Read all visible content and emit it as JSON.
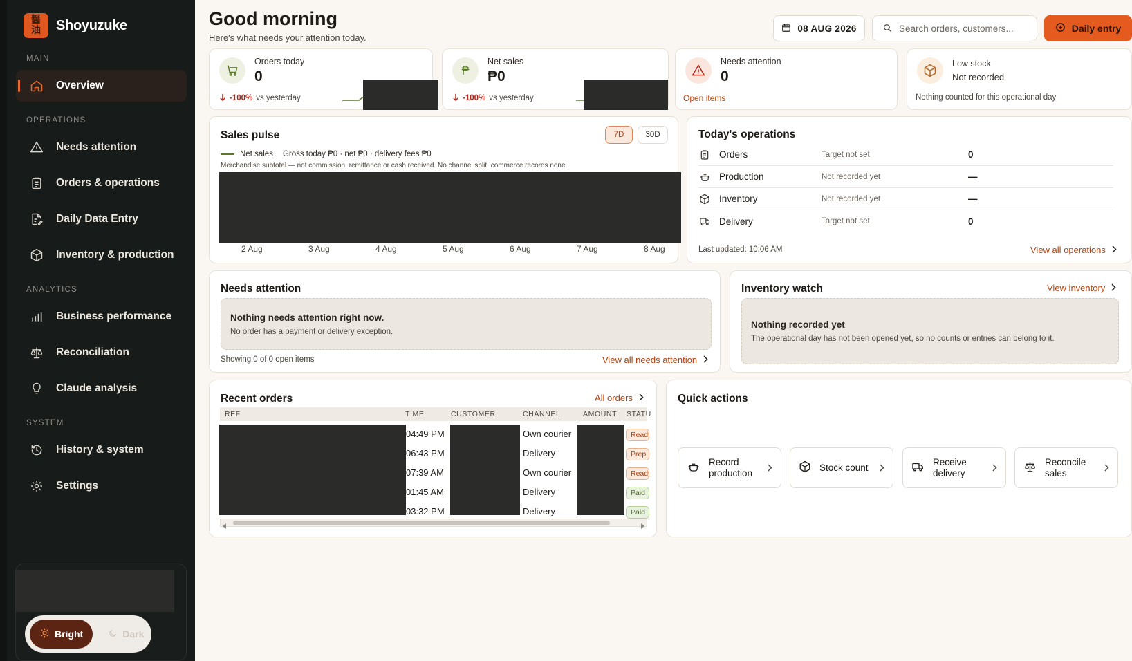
{
  "brand": {
    "name": "Shoyuzuke",
    "logo_top": "醤",
    "logo_bottom": "油"
  },
  "sidebar": {
    "sections": {
      "main": "MAIN",
      "operations": "OPERATIONS",
      "analytics": "ANALYTICS",
      "system": "SYSTEM"
    },
    "items": [
      {
        "label": "Overview",
        "icon": "home-icon"
      },
      {
        "label": "Needs attention",
        "icon": "warning-icon"
      },
      {
        "label": "Orders & operations",
        "icon": "clipboard-icon"
      },
      {
        "label": "Daily Data Entry",
        "icon": "document-edit-icon"
      },
      {
        "label": "Inventory & production",
        "icon": "box-icon"
      },
      {
        "label": "Business performance",
        "icon": "bar-chart-icon"
      },
      {
        "label": "Reconciliation",
        "icon": "scale-icon"
      },
      {
        "label": "Claude analysis",
        "icon": "lightbulb-icon"
      },
      {
        "label": "History & system",
        "icon": "history-icon"
      },
      {
        "label": "Settings",
        "icon": "gear-icon"
      }
    ],
    "theme": {
      "bright": "Bright",
      "dark": "Dark"
    }
  },
  "header": {
    "greeting": "Good morning",
    "subtitle": "Here's what needs your attention today.",
    "date": "08 AUG 2026",
    "search_placeholder": "Search orders, customers...",
    "entry_button": "Daily entry"
  },
  "kpis": {
    "orders": {
      "label": "Orders today",
      "value": "0",
      "delta": "-100%",
      "delta_suffix": "vs yesterday"
    },
    "sales": {
      "label": "Net sales",
      "value": "₱0",
      "delta": "-100%",
      "delta_suffix": "vs yesterday"
    },
    "attention": {
      "label": "Needs attention",
      "value": "0",
      "link": "Open items"
    },
    "stock": {
      "label": "Low stock",
      "value": "Not recorded",
      "note": "Nothing counted for this operational day"
    }
  },
  "sales_pulse": {
    "title": "Sales pulse",
    "ranges": [
      "7D",
      "30D"
    ],
    "selected_range": "7D",
    "legend": "Net sales",
    "summary": "Gross today ₱0 · net ₱0 · delivery fees ₱0",
    "note": "Merchandise subtotal — not commission, remittance or cash received. No channel split: commerce records none.",
    "x_labels": [
      "2 Aug",
      "3 Aug",
      "4 Aug",
      "5 Aug",
      "6 Aug",
      "7 Aug",
      "8 Aug"
    ]
  },
  "operations": {
    "title": "Today's operations",
    "rows": [
      {
        "name": "Orders",
        "status": "Target not set",
        "value": "0",
        "icon": "clipboard-icon"
      },
      {
        "name": "Production",
        "status": "Not recorded yet",
        "value": "—",
        "icon": "pot-icon"
      },
      {
        "name": "Inventory",
        "status": "Not recorded yet",
        "value": "—",
        "icon": "box-icon"
      },
      {
        "name": "Delivery",
        "status": "Target not set",
        "value": "0",
        "icon": "truck-icon"
      }
    ],
    "updated": "Last updated: 10:06 AM",
    "link": "View all operations"
  },
  "needs_attention": {
    "title": "Needs attention",
    "empty_title": "Nothing needs attention right now.",
    "empty_sub": "No order has a payment or delivery exception.",
    "count": "Showing 0 of 0 open items",
    "link": "View all needs attention"
  },
  "inventory_watch": {
    "title": "Inventory watch",
    "link": "View inventory",
    "empty_title": "Nothing recorded yet",
    "empty_sub": "The operational day has not been opened yet, so no counts or entries can belong to it."
  },
  "recent_orders": {
    "title": "Recent orders",
    "link": "All orders",
    "columns": [
      "REF",
      "TIME",
      "CUSTOMER",
      "CHANNEL",
      "AMOUNT",
      "STATU"
    ],
    "rows": [
      {
        "time": "04:49 PM",
        "channel": "Own courier",
        "status": "Ready",
        "status_kind": "ready"
      },
      {
        "time": "06:43 PM",
        "channel": "Delivery",
        "status": "Prep",
        "status_kind": "prep"
      },
      {
        "time": "07:39 AM",
        "channel": "Own courier",
        "status": "Ready",
        "status_kind": "ready"
      },
      {
        "time": "01:45 AM",
        "channel": "Delivery",
        "status": "Paid",
        "status_kind": "paid"
      },
      {
        "time": "03:32 PM",
        "channel": "Delivery",
        "status": "Paid",
        "status_kind": "paid"
      }
    ]
  },
  "quick_actions": {
    "title": "Quick actions",
    "items": [
      {
        "label": "Record production",
        "icon": "pot-icon"
      },
      {
        "label": "Stock count",
        "icon": "box-icon"
      },
      {
        "label": "Receive delivery",
        "icon": "truck-icon"
      },
      {
        "label": "Reconcile sales",
        "icon": "scale-icon"
      }
    ]
  },
  "colors": {
    "accent": "#e55b1f",
    "sidebar": "#171b1a",
    "background": "#faf7f3",
    "negative": "#b1261a",
    "link": "#b2410f"
  }
}
